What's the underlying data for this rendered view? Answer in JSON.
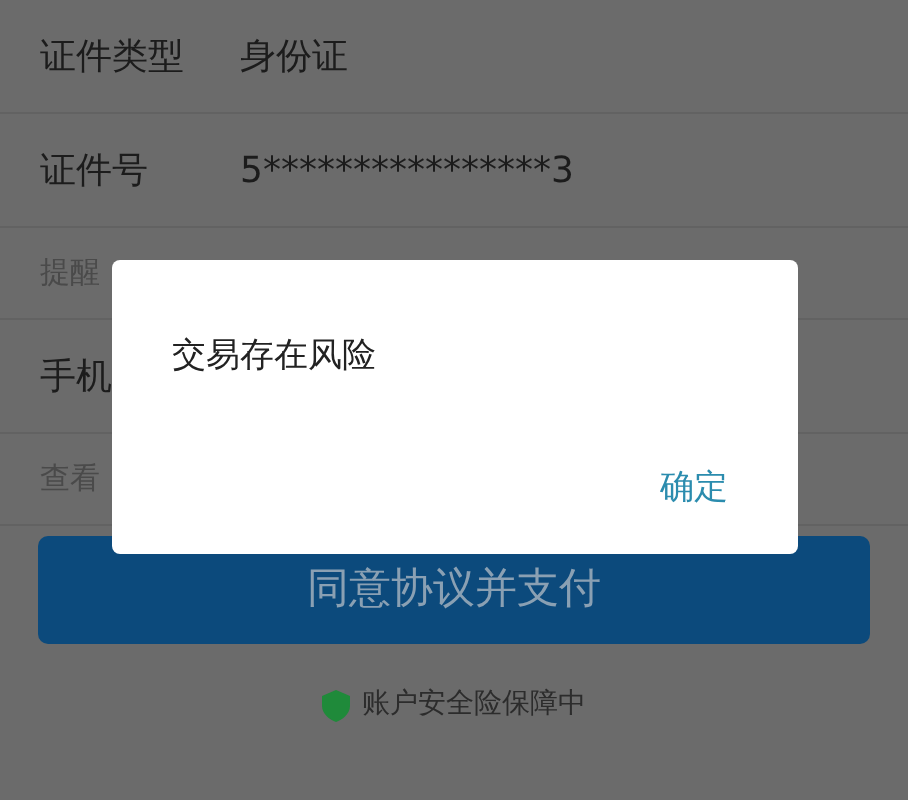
{
  "form": {
    "rows": [
      {
        "kind": "field",
        "label": "证件类型",
        "value": "身份证"
      },
      {
        "kind": "field",
        "label": "证件号",
        "value": "5****************3"
      },
      {
        "kind": "hint",
        "label": "提醒"
      },
      {
        "kind": "field",
        "label": "手机"
      },
      {
        "kind": "hint",
        "label": "查看"
      }
    ]
  },
  "pay_button": "同意协议并支付",
  "footer": "账户安全险保障中",
  "dialog": {
    "message": "交易存在风险",
    "button": "确定"
  }
}
